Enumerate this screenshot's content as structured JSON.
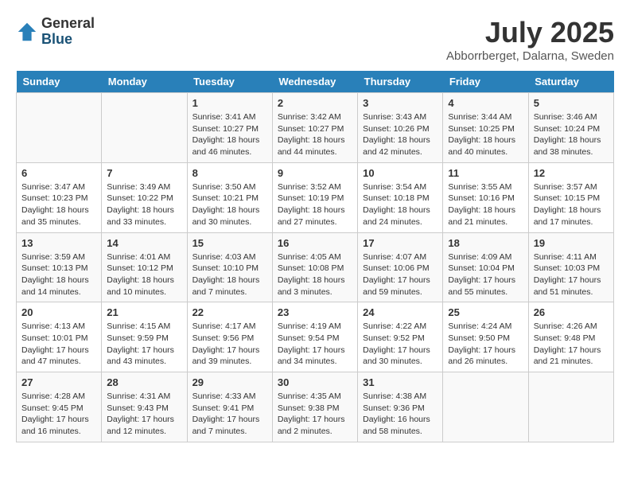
{
  "header": {
    "logo_general": "General",
    "logo_blue": "Blue",
    "month": "July 2025",
    "location": "Abborrberget, Dalarna, Sweden"
  },
  "days_of_week": [
    "Sunday",
    "Monday",
    "Tuesday",
    "Wednesday",
    "Thursday",
    "Friday",
    "Saturday"
  ],
  "weeks": [
    [
      {
        "num": "",
        "info": ""
      },
      {
        "num": "",
        "info": ""
      },
      {
        "num": "1",
        "info": "Sunrise: 3:41 AM\nSunset: 10:27 PM\nDaylight: 18 hours and 46 minutes."
      },
      {
        "num": "2",
        "info": "Sunrise: 3:42 AM\nSunset: 10:27 PM\nDaylight: 18 hours and 44 minutes."
      },
      {
        "num": "3",
        "info": "Sunrise: 3:43 AM\nSunset: 10:26 PM\nDaylight: 18 hours and 42 minutes."
      },
      {
        "num": "4",
        "info": "Sunrise: 3:44 AM\nSunset: 10:25 PM\nDaylight: 18 hours and 40 minutes."
      },
      {
        "num": "5",
        "info": "Sunrise: 3:46 AM\nSunset: 10:24 PM\nDaylight: 18 hours and 38 minutes."
      }
    ],
    [
      {
        "num": "6",
        "info": "Sunrise: 3:47 AM\nSunset: 10:23 PM\nDaylight: 18 hours and 35 minutes."
      },
      {
        "num": "7",
        "info": "Sunrise: 3:49 AM\nSunset: 10:22 PM\nDaylight: 18 hours and 33 minutes."
      },
      {
        "num": "8",
        "info": "Sunrise: 3:50 AM\nSunset: 10:21 PM\nDaylight: 18 hours and 30 minutes."
      },
      {
        "num": "9",
        "info": "Sunrise: 3:52 AM\nSunset: 10:19 PM\nDaylight: 18 hours and 27 minutes."
      },
      {
        "num": "10",
        "info": "Sunrise: 3:54 AM\nSunset: 10:18 PM\nDaylight: 18 hours and 24 minutes."
      },
      {
        "num": "11",
        "info": "Sunrise: 3:55 AM\nSunset: 10:16 PM\nDaylight: 18 hours and 21 minutes."
      },
      {
        "num": "12",
        "info": "Sunrise: 3:57 AM\nSunset: 10:15 PM\nDaylight: 18 hours and 17 minutes."
      }
    ],
    [
      {
        "num": "13",
        "info": "Sunrise: 3:59 AM\nSunset: 10:13 PM\nDaylight: 18 hours and 14 minutes."
      },
      {
        "num": "14",
        "info": "Sunrise: 4:01 AM\nSunset: 10:12 PM\nDaylight: 18 hours and 10 minutes."
      },
      {
        "num": "15",
        "info": "Sunrise: 4:03 AM\nSunset: 10:10 PM\nDaylight: 18 hours and 7 minutes."
      },
      {
        "num": "16",
        "info": "Sunrise: 4:05 AM\nSunset: 10:08 PM\nDaylight: 18 hours and 3 minutes."
      },
      {
        "num": "17",
        "info": "Sunrise: 4:07 AM\nSunset: 10:06 PM\nDaylight: 17 hours and 59 minutes."
      },
      {
        "num": "18",
        "info": "Sunrise: 4:09 AM\nSunset: 10:04 PM\nDaylight: 17 hours and 55 minutes."
      },
      {
        "num": "19",
        "info": "Sunrise: 4:11 AM\nSunset: 10:03 PM\nDaylight: 17 hours and 51 minutes."
      }
    ],
    [
      {
        "num": "20",
        "info": "Sunrise: 4:13 AM\nSunset: 10:01 PM\nDaylight: 17 hours and 47 minutes."
      },
      {
        "num": "21",
        "info": "Sunrise: 4:15 AM\nSunset: 9:59 PM\nDaylight: 17 hours and 43 minutes."
      },
      {
        "num": "22",
        "info": "Sunrise: 4:17 AM\nSunset: 9:56 PM\nDaylight: 17 hours and 39 minutes."
      },
      {
        "num": "23",
        "info": "Sunrise: 4:19 AM\nSunset: 9:54 PM\nDaylight: 17 hours and 34 minutes."
      },
      {
        "num": "24",
        "info": "Sunrise: 4:22 AM\nSunset: 9:52 PM\nDaylight: 17 hours and 30 minutes."
      },
      {
        "num": "25",
        "info": "Sunrise: 4:24 AM\nSunset: 9:50 PM\nDaylight: 17 hours and 26 minutes."
      },
      {
        "num": "26",
        "info": "Sunrise: 4:26 AM\nSunset: 9:48 PM\nDaylight: 17 hours and 21 minutes."
      }
    ],
    [
      {
        "num": "27",
        "info": "Sunrise: 4:28 AM\nSunset: 9:45 PM\nDaylight: 17 hours and 16 minutes."
      },
      {
        "num": "28",
        "info": "Sunrise: 4:31 AM\nSunset: 9:43 PM\nDaylight: 17 hours and 12 minutes."
      },
      {
        "num": "29",
        "info": "Sunrise: 4:33 AM\nSunset: 9:41 PM\nDaylight: 17 hours and 7 minutes."
      },
      {
        "num": "30",
        "info": "Sunrise: 4:35 AM\nSunset: 9:38 PM\nDaylight: 17 hours and 2 minutes."
      },
      {
        "num": "31",
        "info": "Sunrise: 4:38 AM\nSunset: 9:36 PM\nDaylight: 16 hours and 58 minutes."
      },
      {
        "num": "",
        "info": ""
      },
      {
        "num": "",
        "info": ""
      }
    ]
  ]
}
